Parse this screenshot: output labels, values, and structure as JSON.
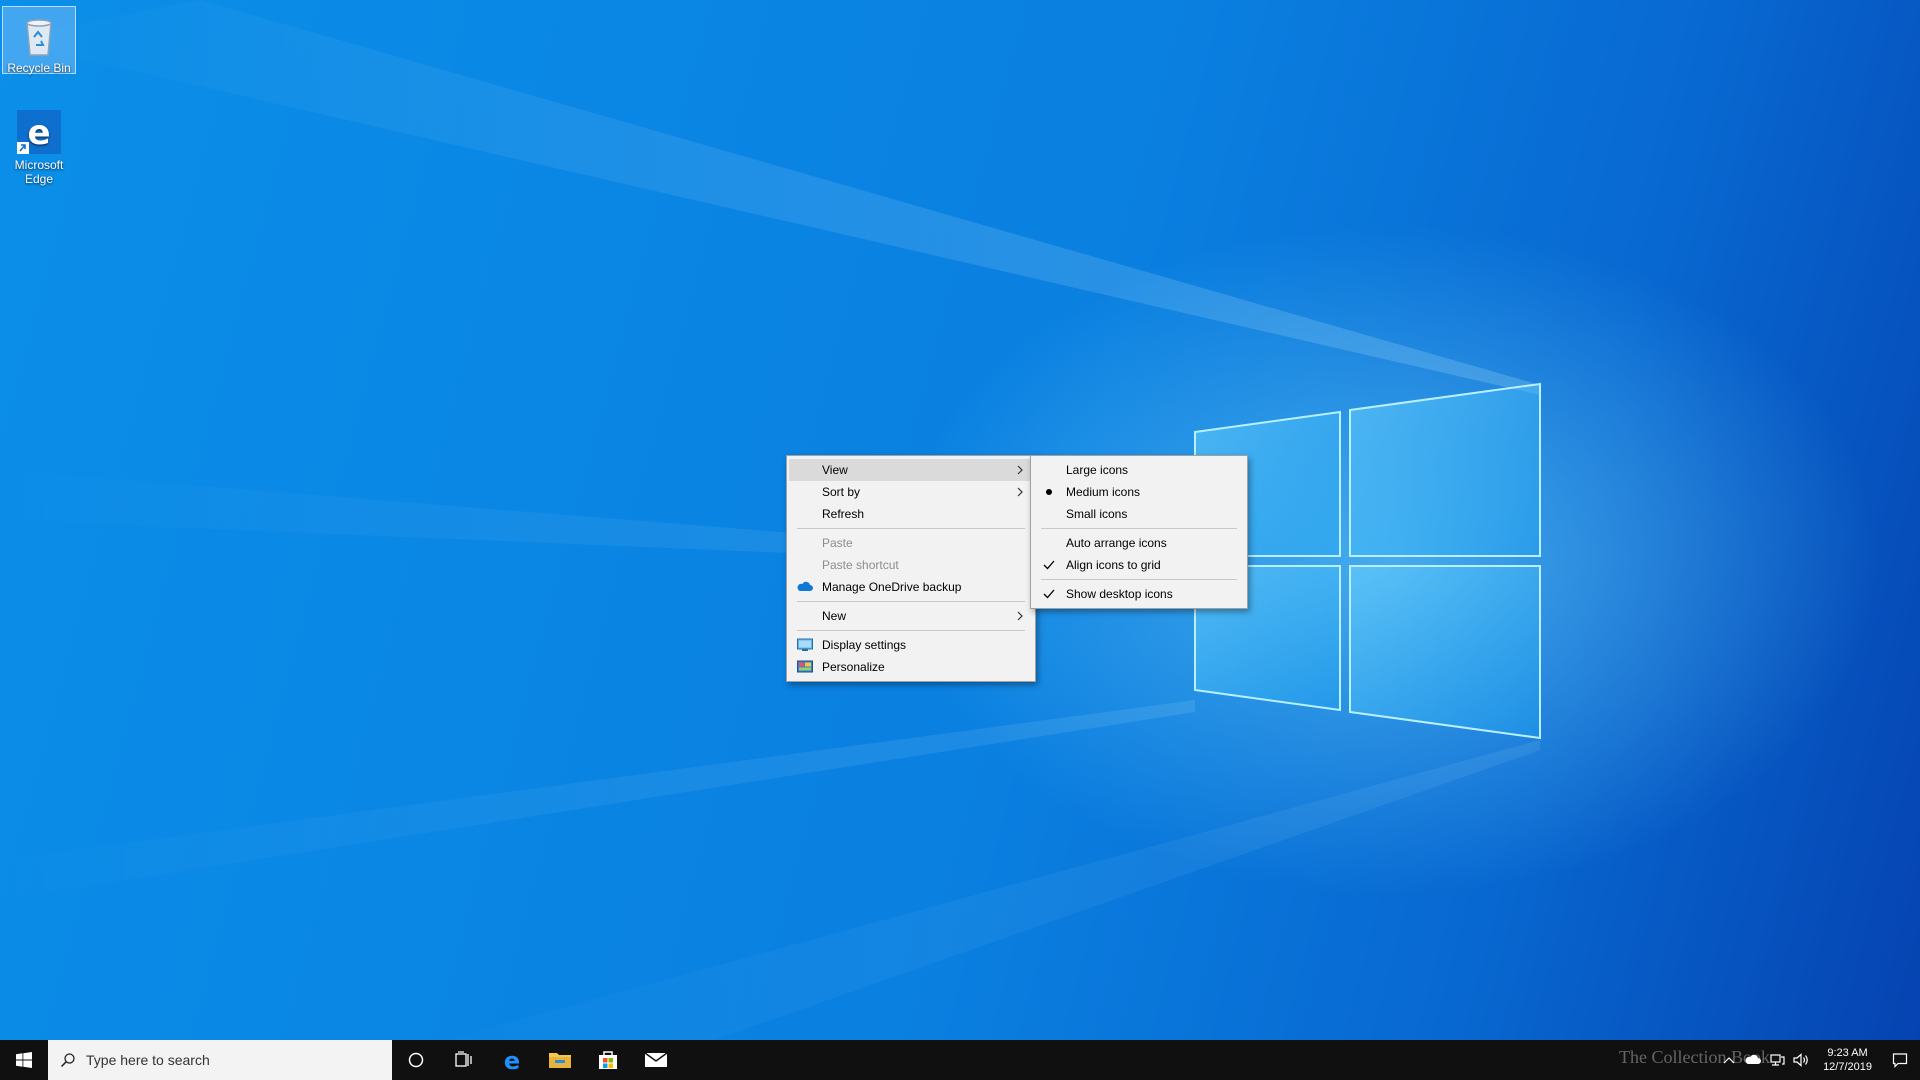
{
  "desktop": {
    "icons": [
      {
        "label": "Recycle Bin",
        "icon": "recycle-bin-icon"
      },
      {
        "label": "Microsoft Edge",
        "icon": "edge-icon"
      }
    ]
  },
  "context_menu": {
    "items": [
      {
        "label": "View",
        "submenu": true,
        "state": "hover"
      },
      {
        "label": "Sort by",
        "submenu": true
      },
      {
        "label": "Refresh"
      },
      {
        "label": "Paste",
        "disabled": true
      },
      {
        "label": "Paste shortcut",
        "disabled": true
      },
      {
        "label": "Manage OneDrive backup",
        "icon": "onedrive-icon"
      },
      {
        "label": "New",
        "submenu": true
      },
      {
        "label": "Display settings",
        "icon": "display-icon"
      },
      {
        "label": "Personalize",
        "icon": "personalize-icon"
      }
    ]
  },
  "view_submenu": {
    "items": [
      {
        "label": "Large icons"
      },
      {
        "label": "Medium icons",
        "mark": "bullet"
      },
      {
        "label": "Small icons"
      },
      {
        "label": "Auto arrange icons"
      },
      {
        "label": "Align icons to grid",
        "mark": "check"
      },
      {
        "label": "Show desktop icons",
        "mark": "check"
      }
    ]
  },
  "taskbar": {
    "search_placeholder": "Type here to search",
    "pinned": [
      "cortana-icon",
      "task-view-icon",
      "edge-icon",
      "file-explorer-icon",
      "store-icon",
      "mail-icon"
    ],
    "clock_time": "9:23 AM",
    "clock_date": "12/7/2019",
    "watermark": "The Collection Book"
  },
  "colors": {
    "menu_bg": "#f2f2f2",
    "menu_hover": "#dadada",
    "taskbar_bg": "#101010",
    "accent": "#0078d7"
  }
}
